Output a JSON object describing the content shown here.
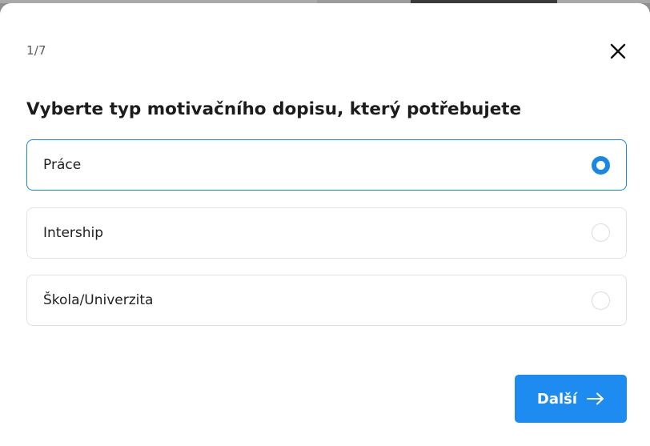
{
  "modal": {
    "step_counter": "1/7",
    "title": "Vyberte typ motivačního dopisu, který potřebujete",
    "options": [
      {
        "label": "Práce",
        "selected": true
      },
      {
        "label": "Intership",
        "selected": false
      },
      {
        "label": "Škola/Univerzita",
        "selected": false
      }
    ],
    "next_label": "Další",
    "colors": {
      "accent": "#1e8bf0",
      "selected_border": "#1a86e6",
      "unselected_border": "#e2e2e2"
    },
    "icons": {
      "close": "close-icon",
      "next_arrow": "arrow-right-icon"
    }
  }
}
